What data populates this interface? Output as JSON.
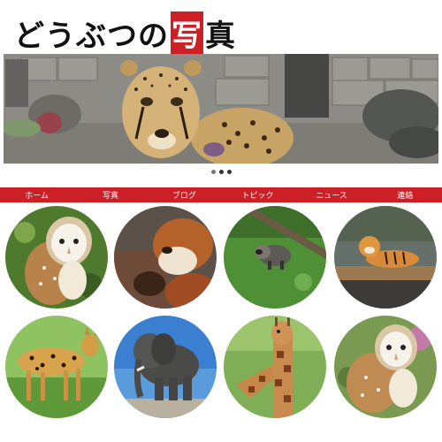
{
  "site": {
    "title_part1": "どうぶつの",
    "title_highlight": "写",
    "title_part2": "真"
  },
  "hero": {
    "image": "cheetah-photo",
    "slides": 3,
    "active_slide": 2
  },
  "nav": {
    "items": [
      {
        "label": "ホーム"
      },
      {
        "label": "写真"
      },
      {
        "label": "ブログ"
      },
      {
        "label": "トピック"
      },
      {
        "label": "ニュース"
      },
      {
        "label": "連絡"
      }
    ]
  },
  "gallery": {
    "items": [
      {
        "animal": "barn-owl"
      },
      {
        "animal": "red-panda"
      },
      {
        "animal": "raccoon-dog"
      },
      {
        "animal": "tiger"
      },
      {
        "animal": "serval"
      },
      {
        "animal": "elephant"
      },
      {
        "animal": "giraffe"
      },
      {
        "animal": "barn-owl"
      }
    ]
  },
  "colors": {
    "accent": "#cc1f26",
    "nav_text": "#ffffff",
    "dot_active": "#333333"
  }
}
